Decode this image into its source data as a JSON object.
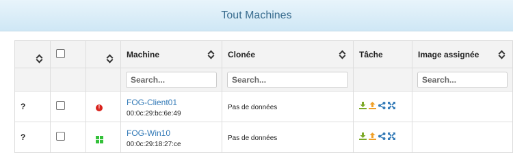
{
  "page": {
    "title": "Tout Machines"
  },
  "table": {
    "headers": {
      "machine": "Machine",
      "cloned": "Clonée",
      "task": "Tâche",
      "image": "Image assignée"
    },
    "search_placeholder": "Search...",
    "rows": [
      {
        "status_label": "?",
        "status_icon": "error-icon",
        "name": "FOG-Client01",
        "mac": "00:0c:29:bc:6e:49",
        "cloned": "Pas de données",
        "image": ""
      },
      {
        "status_label": "?",
        "status_icon": "windows-icon",
        "name": "FOG-Win10",
        "mac": "00:0c:29:18:27:ce",
        "cloned": "Pas de données",
        "image": ""
      }
    ]
  },
  "icons": {
    "task_icons": [
      "download-icon",
      "upload-icon",
      "share-icon",
      "expand-icon"
    ],
    "colors": {
      "download": "#7da928",
      "upload": "#f0a028",
      "share": "#337ab7",
      "expand": "#337ab7",
      "error": "#d9231d",
      "windows": "#34c13a"
    }
  }
}
